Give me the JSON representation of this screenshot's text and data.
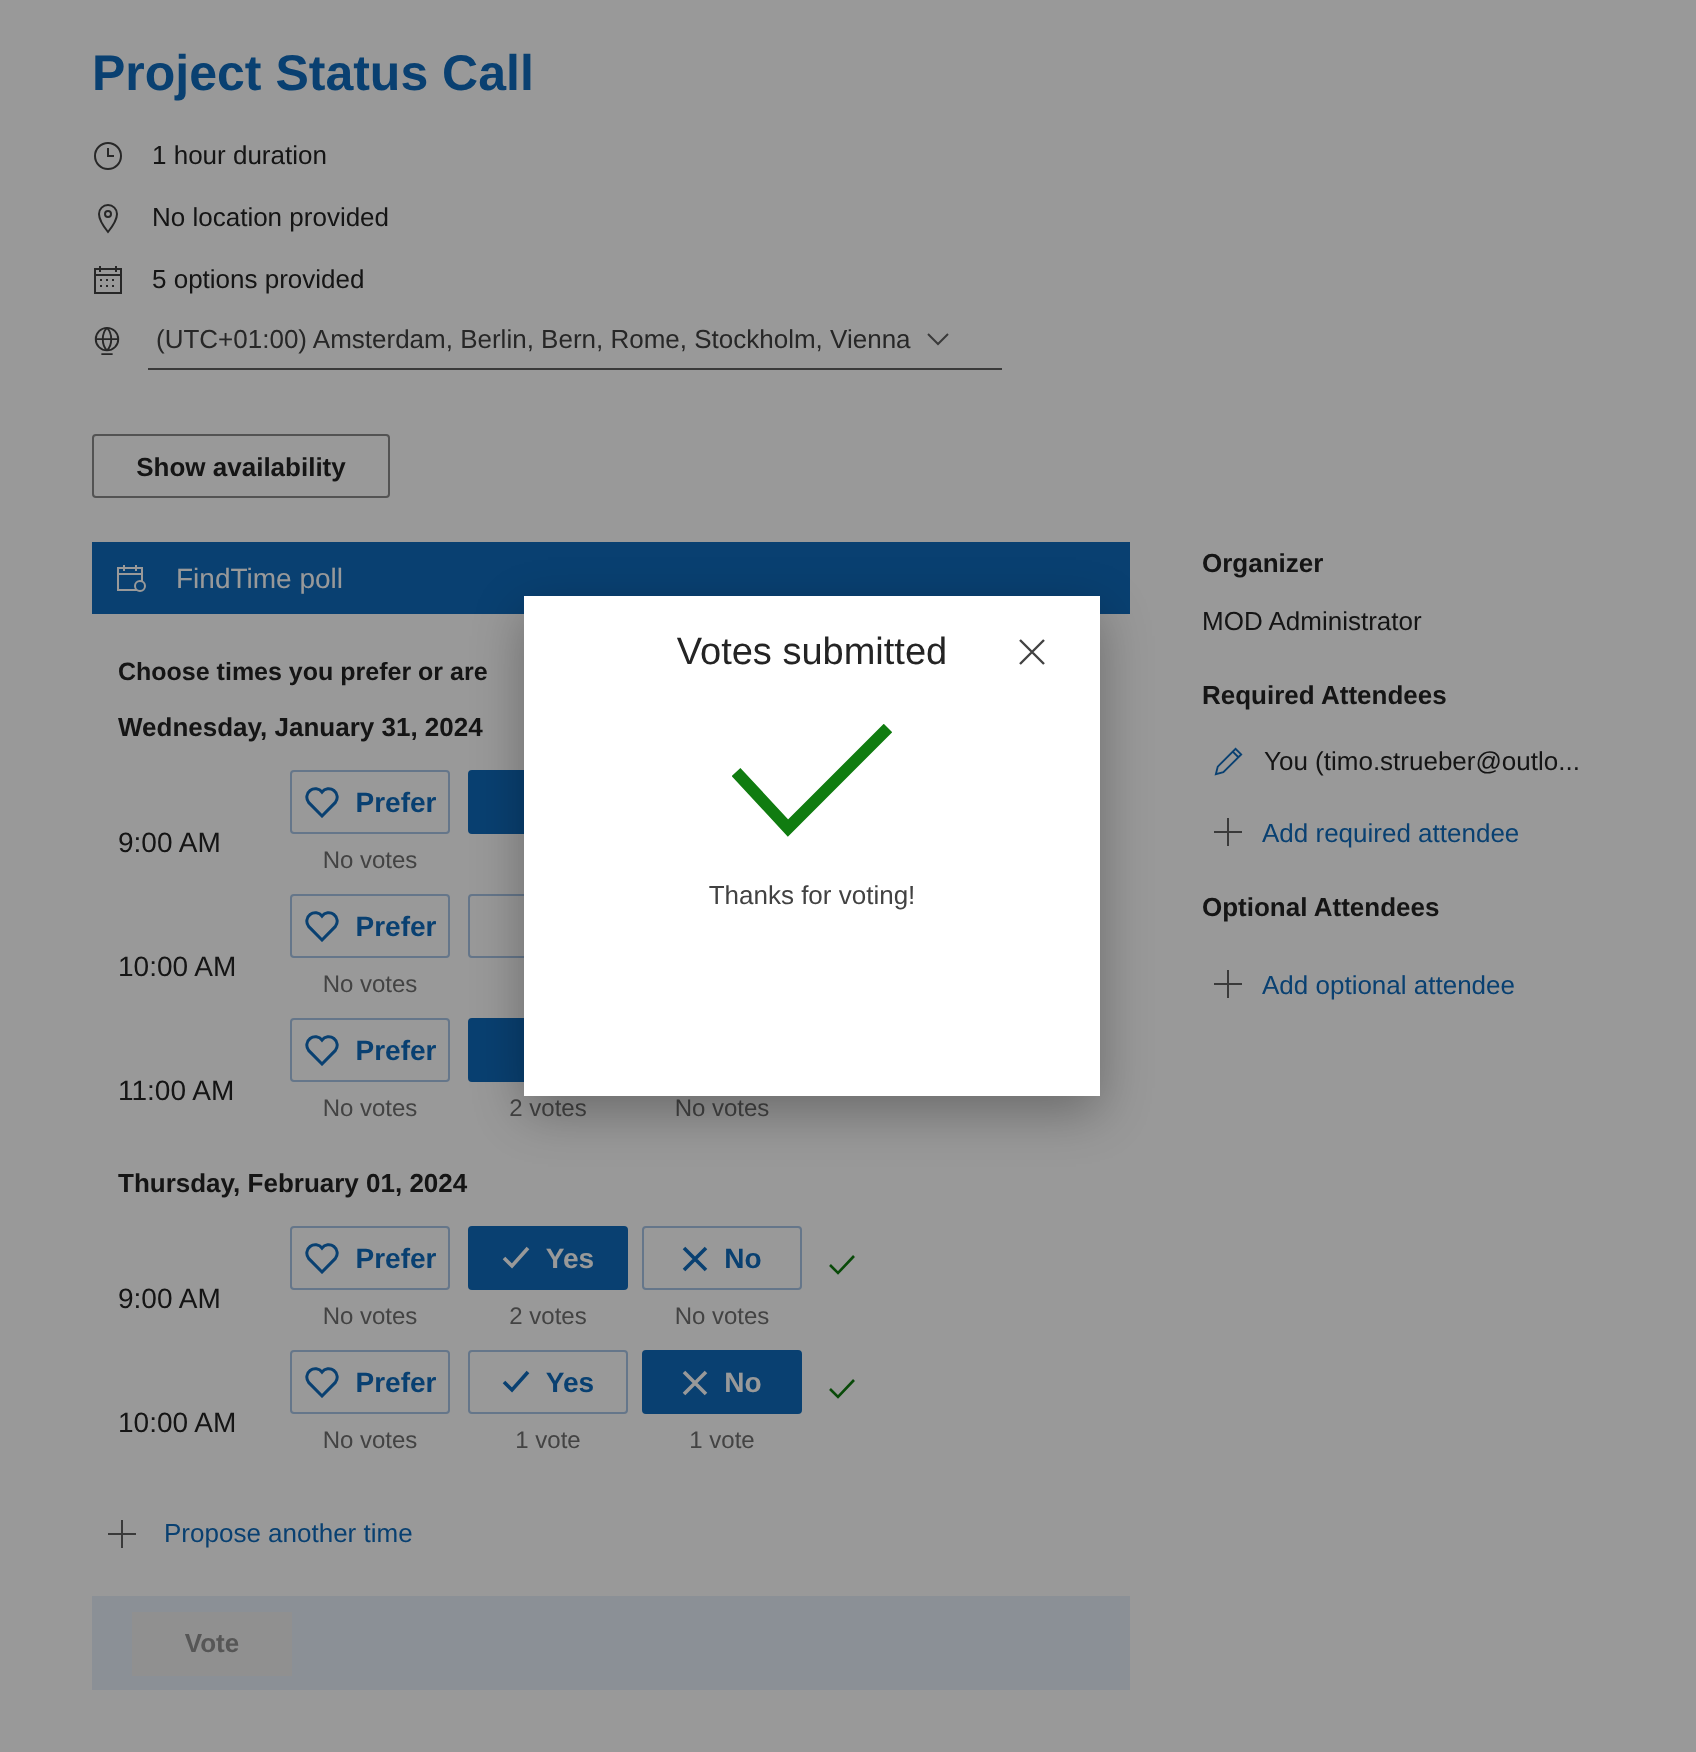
{
  "title": "Project Status Call",
  "details": [
    {
      "kind": "duration",
      "text": "1 hour duration"
    },
    {
      "kind": "location",
      "text": "No location provided"
    },
    {
      "kind": "options",
      "text": "5 options provided"
    }
  ],
  "timezone": {
    "value": "(UTC+01:00) Amsterdam, Berlin, Bern, Rome, Stockholm, Vienna"
  },
  "show_availability_button": "Show availability",
  "poll": {
    "header": "FindTime poll",
    "instructions": "Choose times you prefer or are",
    "days": [
      {
        "date": "Wednesday, January 31, 2024",
        "slots": [
          {
            "time": "9:00 AM",
            "responses": [
              {
                "kind": "prefer",
                "label": "Prefer",
                "selected": false,
                "votes": "No votes"
              },
              {
                "kind": "yes",
                "selected": true
              }
            ]
          },
          {
            "time": "10:00 AM",
            "responses": [
              {
                "kind": "prefer",
                "label": "Prefer",
                "selected": false,
                "votes": "No votes"
              },
              {
                "kind": "yes",
                "selected": false
              }
            ]
          },
          {
            "time": "11:00 AM",
            "responses": [
              {
                "kind": "prefer",
                "label": "Prefer",
                "selected": false,
                "votes": "No votes"
              },
              {
                "kind": "yes",
                "selected": true,
                "votes": "2 votes"
              },
              {
                "kind": "no",
                "votes": "No votes"
              }
            ]
          }
        ]
      },
      {
        "date": "Thursday, February 01, 2024",
        "slots": [
          {
            "time": "9:00 AM",
            "confirmed": true,
            "responses": [
              {
                "kind": "prefer",
                "label": "Prefer",
                "selected": false,
                "votes": "No votes"
              },
              {
                "kind": "yes",
                "label": "Yes",
                "selected": true,
                "votes": "2 votes"
              },
              {
                "kind": "no",
                "label": "No",
                "selected": false,
                "votes": "No votes"
              }
            ]
          },
          {
            "time": "10:00 AM",
            "confirmed": true,
            "responses": [
              {
                "kind": "prefer",
                "label": "Prefer",
                "selected": false,
                "votes": "No votes"
              },
              {
                "kind": "yes",
                "label": "Yes",
                "selected": false,
                "votes": "1 vote"
              },
              {
                "kind": "no",
                "label": "No",
                "selected": true,
                "votes": "1 vote"
              }
            ]
          }
        ]
      }
    ],
    "propose_link": "Propose another time",
    "vote_button": {
      "label": "Vote",
      "disabled": true
    }
  },
  "attendees": {
    "organizer_heading": "Organizer",
    "organizer": "MOD Administrator",
    "required_heading": "Required Attendees",
    "required": [
      "You (timo.strueber@outlo..."
    ],
    "add_required": "Add required attendee",
    "optional_heading": "Optional Attendees",
    "add_optional": "Add optional attendee"
  },
  "dialog": {
    "title": "Votes submitted",
    "message": "Thanks for voting!"
  }
}
